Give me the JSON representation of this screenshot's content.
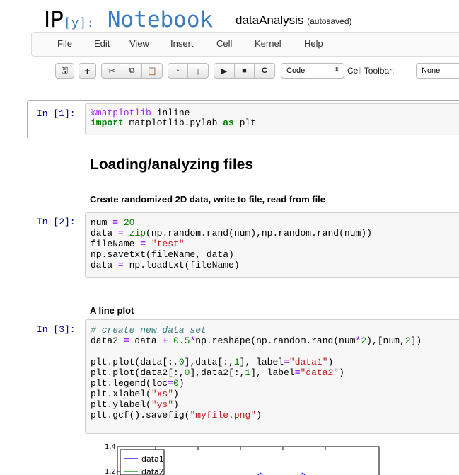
{
  "header": {
    "logo_ip": "IP",
    "logo_y": "[y]:",
    "logo_notebook": " Notebook",
    "notebook_name": "dataAnalysis",
    "save_status": "(autosaved)"
  },
  "menu": [
    "File",
    "Edit",
    "View",
    "Insert",
    "Cell",
    "Kernel",
    "Help"
  ],
  "toolbar": {
    "buttons": [
      {
        "icon": "save-icon",
        "glyph": "🖫"
      },
      {
        "icon": "plus-icon",
        "glyph": "+"
      },
      {
        "icon": "scissors-icon",
        "glyph": "✂"
      },
      {
        "icon": "copy-icon",
        "glyph": "⧉"
      },
      {
        "icon": "paste-icon",
        "glyph": "📋"
      },
      {
        "icon": "arrow-up-icon",
        "glyph": "↑"
      },
      {
        "icon": "arrow-down-icon",
        "glyph": "↓"
      },
      {
        "icon": "play-icon",
        "glyph": "▶"
      },
      {
        "icon": "stop-icon",
        "glyph": "■"
      },
      {
        "icon": "restart-icon",
        "glyph": "C"
      }
    ],
    "cell_type": "Code",
    "cell_toolbar_label": "Cell Toolbar:",
    "cell_toolbar_value": "None"
  },
  "cells": {
    "c1": {
      "prompt": "In [1]:",
      "l1a": "%matplotlib",
      "l1b": " inline",
      "l2a": "import",
      "l2b": " matplotlib.pylab ",
      "l2c": "as",
      "l2d": " plt"
    },
    "md1": "Loading/analyzing files",
    "md2": "Create randomized 2D data, write to file, read from file",
    "c2": {
      "prompt": "In [2]:",
      "l1a": "num ",
      "l1b": "=",
      "l1c": " ",
      "l1d": "20",
      "l2a": "data ",
      "l2b": "=",
      "l2c": " ",
      "l2d": "zip",
      "l2e": "(np.random.rand(num),np.random.rand(num))",
      "l3a": "fileName ",
      "l3b": "=",
      "l3c": " ",
      "l3d": "\"test\"",
      "l4": "np.savetxt(fileName, data)",
      "l5a": "data ",
      "l5b": "=",
      "l5c": " np.loadtxt(fileName)"
    },
    "md3": "A line plot",
    "c3": {
      "prompt": "In [3]:",
      "l1": "# create new data set",
      "l2a": "data2 ",
      "l2b": "=",
      "l2c": " data ",
      "l2d": "+",
      "l2e": " ",
      "l2f": "0.5",
      "l2g": "*",
      "l2h": "np.reshape(np.random.rand(num",
      "l2i": "*",
      "l2j": "2",
      "l2k": "),[num,",
      "l2l": "2",
      "l2m": "])",
      "l3a": "plt.plot(data[:,",
      "l3b": "0",
      "l3c": "],data[:,",
      "l3d": "1",
      "l3e": "], label",
      "l3f": "=",
      "l3g": "\"data1\"",
      "l3h": ")",
      "l4a": "plt.plot(data2[:,",
      "l4b": "0",
      "l4c": "],data2[:,",
      "l4d": "1",
      "l4e": "], label",
      "l4f": "=",
      "l4g": "\"data2\"",
      "l4h": ")",
      "l5a": "plt.legend(loc",
      "l5b": "=",
      "l5c": "0",
      "l5d": ")",
      "l6a": "plt.xlabel(",
      "l6b": "\"xs\"",
      "l6c": ")",
      "l7a": "plt.ylabel(",
      "l7b": "\"ys\"",
      "l7c": ")",
      "l8a": "plt.gcf().savefig(",
      "l8b": "\"myfile.png\"",
      "l8c": ")"
    }
  },
  "plot": {
    "tick_1": "1.4",
    "tick_2": "1.2",
    "legend_1": "data1",
    "legend_2": "data2",
    "series_color": "#0000ff"
  }
}
